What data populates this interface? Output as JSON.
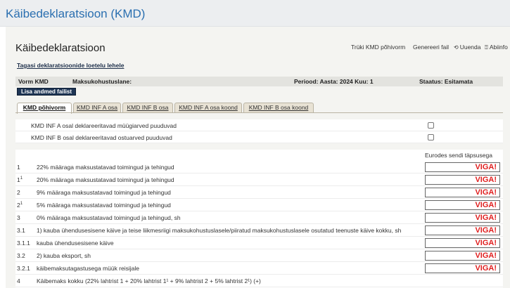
{
  "app": {
    "title": "Käibedeklaratsioon (KMD)"
  },
  "page": {
    "title": "Käibedeklaratsioon"
  },
  "toolbar": {
    "print": "Trüki KMD põhivorm",
    "generate": "Genereeri fail",
    "refresh": "Uuenda",
    "help": "Abiinfo"
  },
  "back_link": "Tagasi deklaratsioonide loetelu lehele",
  "info_bar": {
    "form": "Vorm KMD",
    "payer": "Maksukohustuslane:",
    "period": "Periood: Aasta: 2024 Kuu: 1",
    "status": "Staatus: Esitamata"
  },
  "add_button": "Lisa andmed failist",
  "tabs": [
    {
      "label": "KMD põhivorm",
      "active": true
    },
    {
      "label": "KMD INF A osa",
      "active": false
    },
    {
      "label": "KMD INF B osa",
      "active": false
    },
    {
      "label": "KMD INF A osa koond",
      "active": false
    },
    {
      "label": "KMD INF B osa koond",
      "active": false
    }
  ],
  "checks": [
    {
      "label": "KMD INF A osal deklareeritavad müügiarved puuduvad",
      "checked": false
    },
    {
      "label": "KMD INF B osal deklareeritavad ostuarved puuduvad",
      "checked": false
    }
  ],
  "table": {
    "column_header": "Eurodes sendi täpsusega",
    "rows": [
      {
        "num": "1",
        "sup": "",
        "desc": "22% määraga maksustatavad toimingud ja tehingud",
        "value": "VIGA!"
      },
      {
        "num": "1",
        "sup": "1",
        "desc": "20% määraga maksustatavad toimingud ja tehingud",
        "value": "VIGA!"
      },
      {
        "num": "2",
        "sup": "",
        "desc": "9% määraga maksustatavad toimingud ja tehingud",
        "value": "VIGA!"
      },
      {
        "num": "2",
        "sup": "1",
        "desc": "5% määraga maksustatavad toimingud ja tehingud",
        "value": "VIGA!"
      },
      {
        "num": "3",
        "sup": "",
        "desc": "0% määraga maksustatavad toimingud ja tehingud, sh",
        "value": "VIGA!"
      },
      {
        "num": "3.1",
        "sup": "",
        "desc": "1) kauba ühendusesisene käive ja teise liikmesriigi maksukohustuslasele/piiratud maksukohustuslasele osutatud teenuste käive kokku, sh",
        "value": "VIGA!"
      },
      {
        "num": "3.1.1",
        "sup": "",
        "desc": "kauba ühendusesisene käive",
        "value": "VIGA!"
      },
      {
        "num": "3.2",
        "sup": "",
        "desc": "2) kauba eksport, sh",
        "value": "VIGA!"
      },
      {
        "num": "3.2.1",
        "sup": "",
        "desc": "käibemaksutagastusega müük reisijale",
        "value": "VIGA!"
      },
      {
        "num": "4",
        "sup": "",
        "desc": "Käibemaks kokku (22% lahtrist 1 + 20% lahtrist 1¹ + 9% lahtrist 2 + 5% lahtrist 2¹) (+)",
        "value": ""
      }
    ]
  }
}
